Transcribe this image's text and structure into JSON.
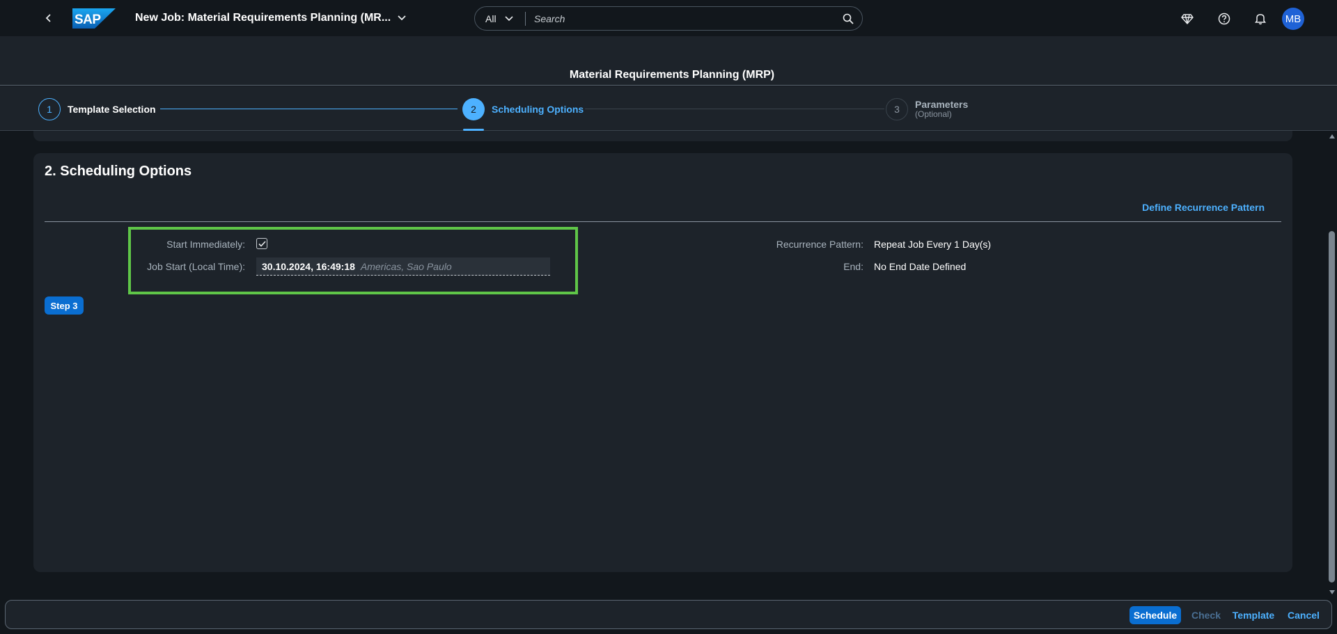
{
  "shell": {
    "logo_text": "SAP",
    "app_title": "New Job: Material Requirements Planning (MR...",
    "search_scope": "All",
    "search_placeholder": "Search",
    "avatar_initials": "MB"
  },
  "header": {
    "title": "Material Requirements Planning (MRP)"
  },
  "wizard": {
    "steps": [
      {
        "number": "1",
        "label": "Template Selection",
        "sublabel": "",
        "state": "completed"
      },
      {
        "number": "2",
        "label": "Scheduling Options",
        "sublabel": "",
        "state": "current"
      },
      {
        "number": "3",
        "label": "Parameters",
        "sublabel": "(Optional)",
        "state": "upcoming"
      }
    ]
  },
  "section": {
    "title": "2. Scheduling Options",
    "recurrence_link": "Define Recurrence Pattern",
    "start_immediately_label": "Start Immediately:",
    "start_immediately_checked": true,
    "job_start_label": "Job Start (Local Time):",
    "job_start_value": "30.10.2024, 16:49:18",
    "job_start_timezone": "Americas, Sao Paulo",
    "recurrence_pattern_label": "Recurrence Pattern:",
    "recurrence_pattern_value": "Repeat Job Every 1 Day(s)",
    "end_label": "End:",
    "end_value": "No End Date Defined",
    "step3_button": "Step 3"
  },
  "footer": {
    "schedule": "Schedule",
    "check": "Check",
    "template": "Template",
    "cancel": "Cancel"
  },
  "colors": {
    "accent": "#4db1ff",
    "primary_button": "#0a6ed1",
    "highlight": "#5fc648",
    "background": "#12171c",
    "surface": "#1d232a"
  }
}
